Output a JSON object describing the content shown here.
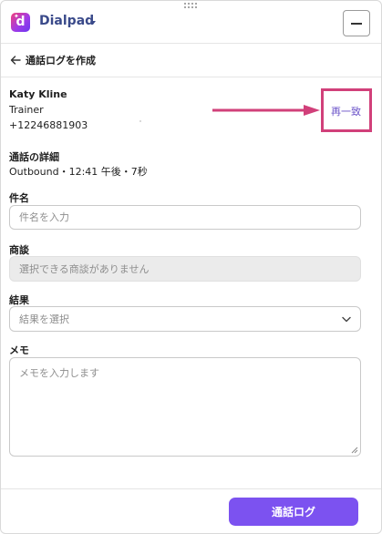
{
  "app": {
    "brand": "Dialpad",
    "brand_color": "#3a4a8a",
    "accent_color": "#7c52f0",
    "highlight_color": "#d1407a"
  },
  "header": {
    "title": "通話ログを作成"
  },
  "contact": {
    "name": "Katy Kline",
    "role": "Trainer",
    "phone": "+12246881903",
    "rematch_label": "再一致"
  },
  "details": {
    "label": "通話の詳細",
    "text": "Outbound・12:41 午後・7秒"
  },
  "subject": {
    "label": "件名",
    "placeholder": "件名を入力"
  },
  "deal": {
    "label": "商談",
    "placeholder": "選択できる商談がありません"
  },
  "outcome": {
    "label": "結果",
    "placeholder": "結果を選択"
  },
  "memo": {
    "label": "メモ",
    "placeholder": "メモを入力します"
  },
  "footer": {
    "submit_label": "通話ログ"
  },
  "icons": [
    "drag-handle-icon",
    "dialpad-logo-icon",
    "caret-down-icon",
    "minimize-icon",
    "back-arrow-icon",
    "annotation-arrow-icon",
    "chevron-down-icon",
    "resize-grip-icon"
  ]
}
